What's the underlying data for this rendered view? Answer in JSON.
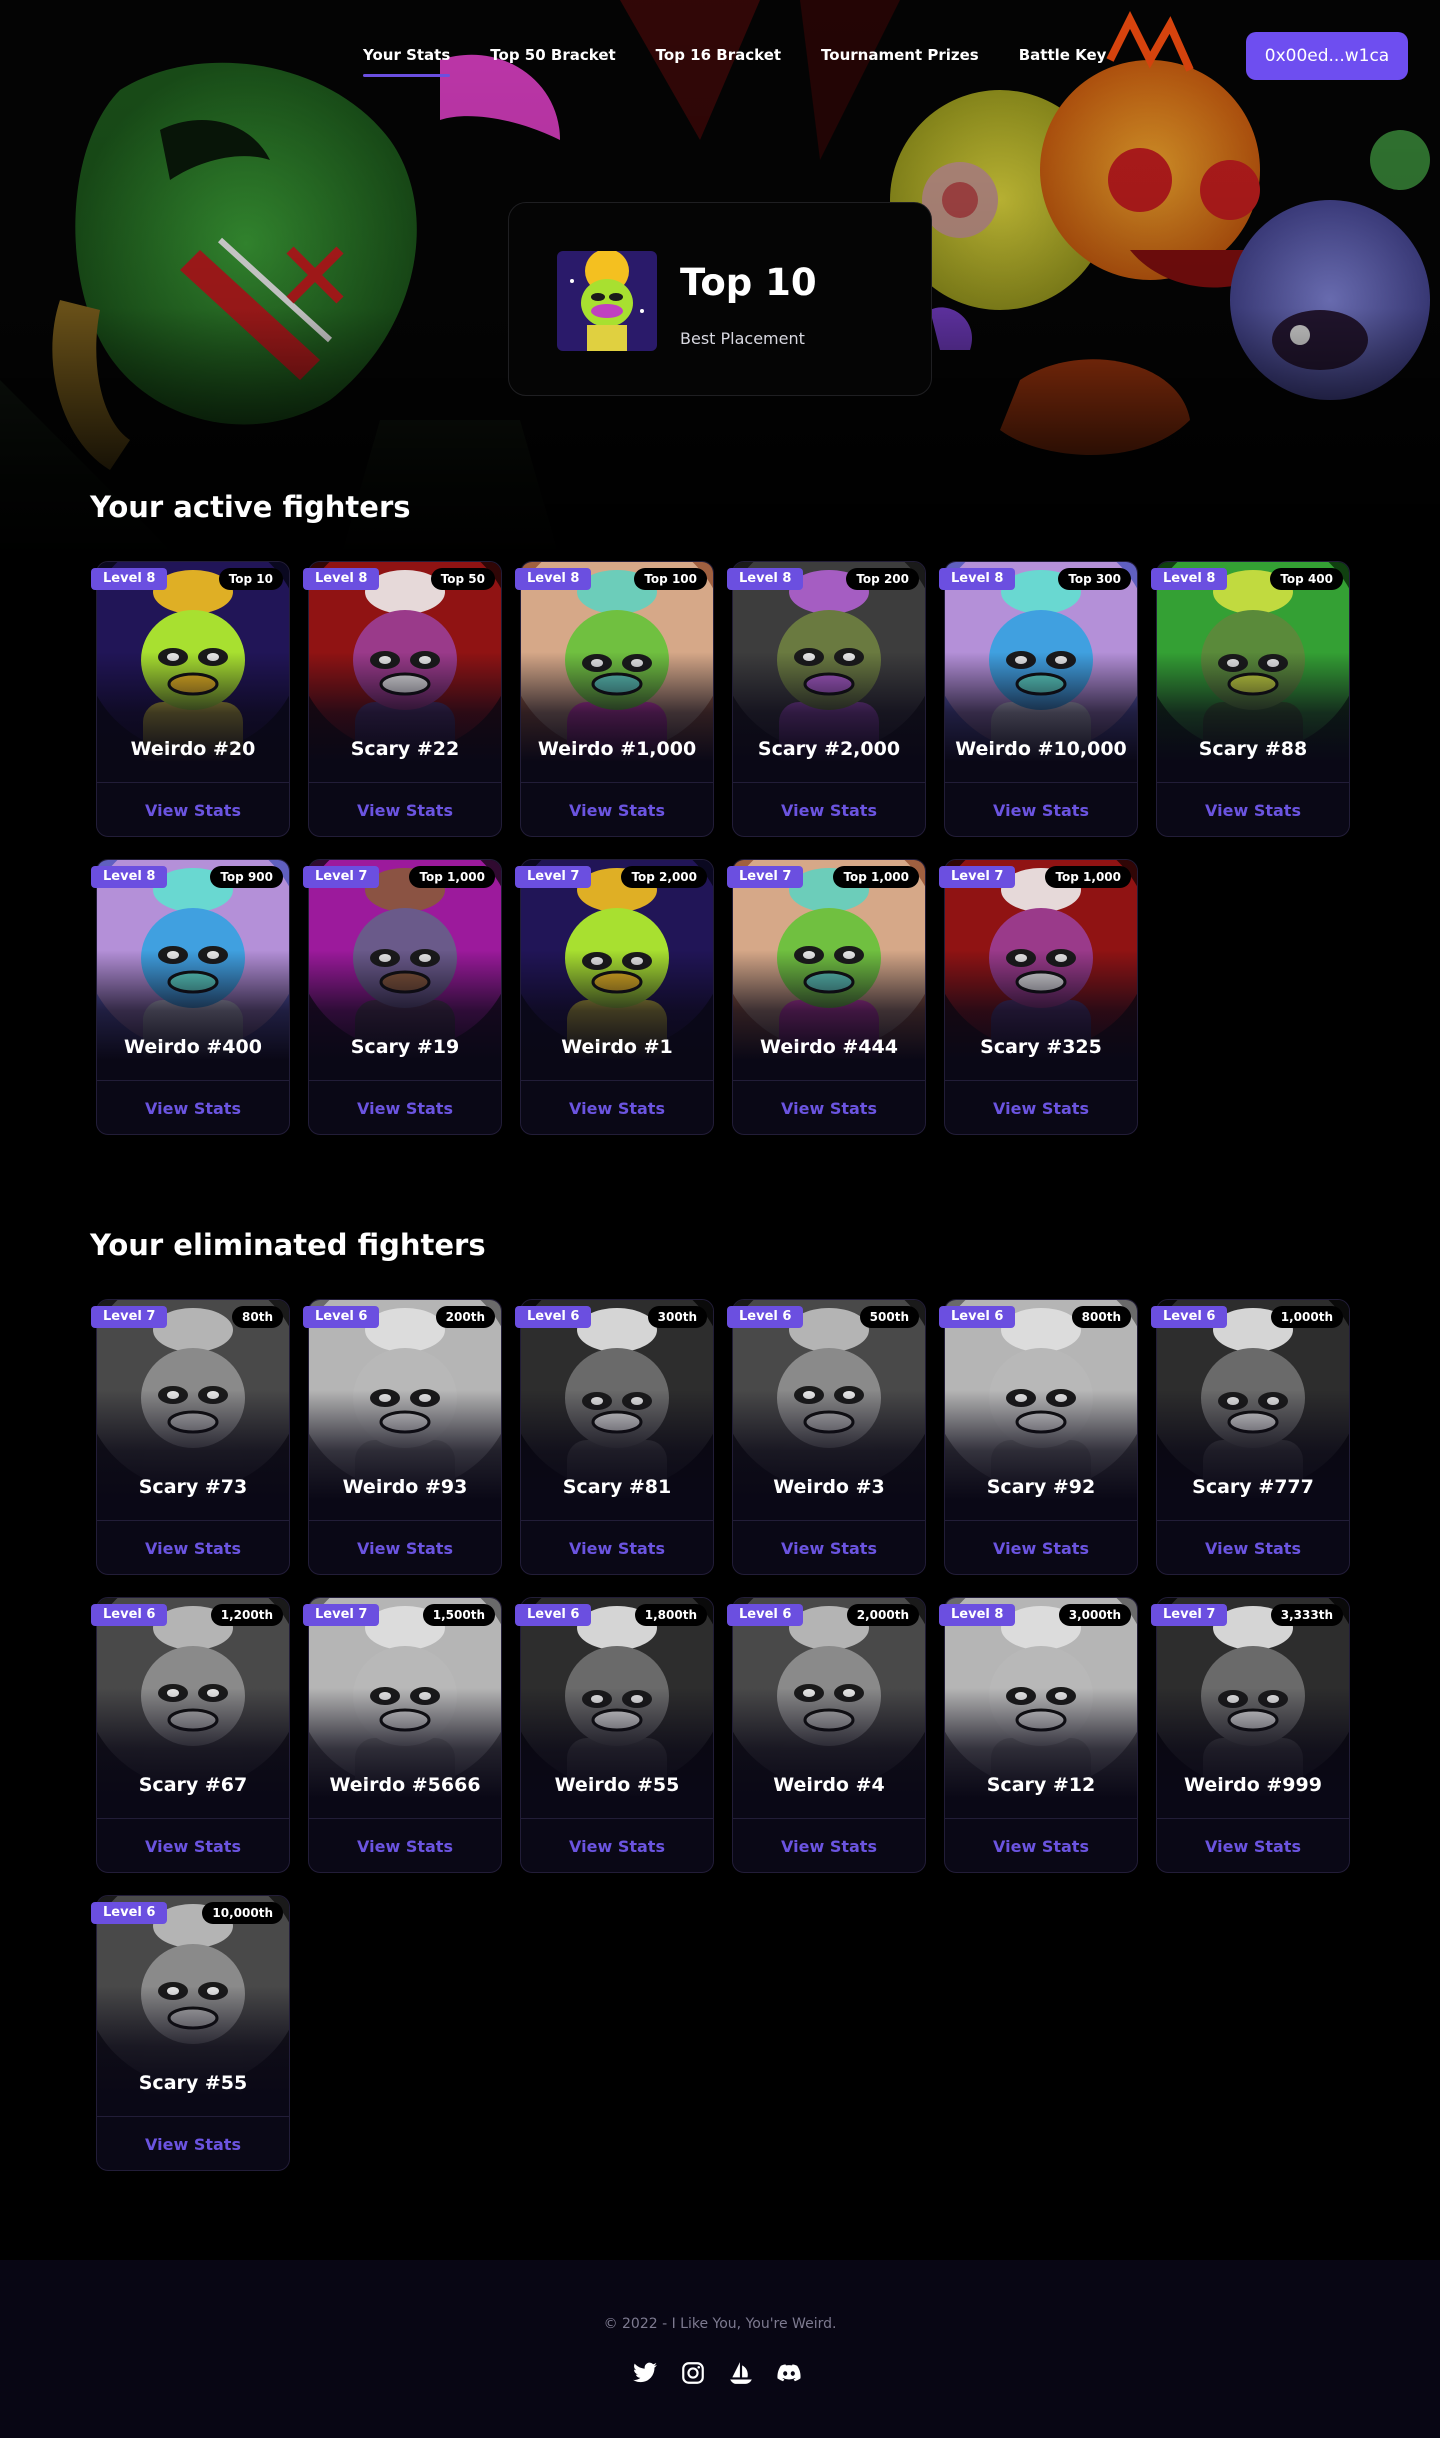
{
  "nav": {
    "links": [
      "Your Stats",
      "Top 50 Bracket",
      "Top 16 Bracket",
      "Tournament Prizes",
      "Battle Key"
    ],
    "active": "Your Stats",
    "wallet": "0x00ed...w1ca"
  },
  "placement": {
    "title": "Top 10",
    "subtitle": "Best Placement"
  },
  "active_section": {
    "title": "Your active fighters",
    "fighters": [
      {
        "name": "Weirdo #20",
        "level": "Level 8",
        "rank": "Top 10",
        "palette": "cosmic"
      },
      {
        "name": "Scary #22",
        "level": "Level 8",
        "rank": "Top 50",
        "palette": "red"
      },
      {
        "name": "Weirdo #1,000",
        "level": "Level 8",
        "rank": "Top 100",
        "palette": "rainbow"
      },
      {
        "name": "Scary #2,000",
        "level": "Level 8",
        "rank": "Top 200",
        "palette": "purple"
      },
      {
        "name": "Weirdo #10,000",
        "level": "Level 8",
        "rank": "Top 300",
        "palette": "pastel"
      },
      {
        "name": "Scary #88",
        "level": "Level 8",
        "rank": "Top 400",
        "palette": "green"
      },
      {
        "name": "Weirdo #400",
        "level": "Level 8",
        "rank": "Top 900",
        "palette": "pastel"
      },
      {
        "name": "Scary #19",
        "level": "Level 7",
        "rank": "Top 1,000",
        "palette": "magenta"
      },
      {
        "name": "Weirdo #1",
        "level": "Level 7",
        "rank": "Top 2,000",
        "palette": "cosmic"
      },
      {
        "name": "Weirdo #444",
        "level": "Level 7",
        "rank": "Top 1,000",
        "palette": "rainbow"
      },
      {
        "name": "Scary #325",
        "level": "Level 7",
        "rank": "Top 1,000",
        "palette": "red"
      }
    ]
  },
  "eliminated_section": {
    "title": "Your eliminated fighters",
    "fighters": [
      {
        "name": "Scary #73",
        "level": "Level 7",
        "rank": "80th"
      },
      {
        "name": "Weirdo #93",
        "level": "Level 6",
        "rank": "200th"
      },
      {
        "name": "Scary #81",
        "level": "Level 6",
        "rank": "300th"
      },
      {
        "name": "Weirdo #3",
        "level": "Level 6",
        "rank": "500th"
      },
      {
        "name": "Scary #92",
        "level": "Level 6",
        "rank": "800th"
      },
      {
        "name": "Scary #777",
        "level": "Level 6",
        "rank": "1,000th"
      },
      {
        "name": "Scary #67",
        "level": "Level 6",
        "rank": "1,200th"
      },
      {
        "name": "Weirdo #5666",
        "level": "Level 7",
        "rank": "1,500th"
      },
      {
        "name": "Weirdo #55",
        "level": "Level 6",
        "rank": "1,800th"
      },
      {
        "name": "Weirdo #4",
        "level": "Level 6",
        "rank": "2,000th"
      },
      {
        "name": "Scary #12",
        "level": "Level 8",
        "rank": "3,000th"
      },
      {
        "name": "Weirdo #999",
        "level": "Level 7",
        "rank": "3,333th"
      },
      {
        "name": "Scary #55",
        "level": "Level 6",
        "rank": "10,000th"
      }
    ]
  },
  "card_link_label": "View Stats",
  "footer": {
    "copyright": "© 2022 - I Like You, You're Weird.",
    "socials": [
      "twitter-icon",
      "instagram-icon",
      "opensea-icon",
      "discord-icon"
    ]
  },
  "colors": {
    "accent": "#6b4fe0",
    "link": "#6b54e0",
    "card_bg": "#0a0816"
  }
}
